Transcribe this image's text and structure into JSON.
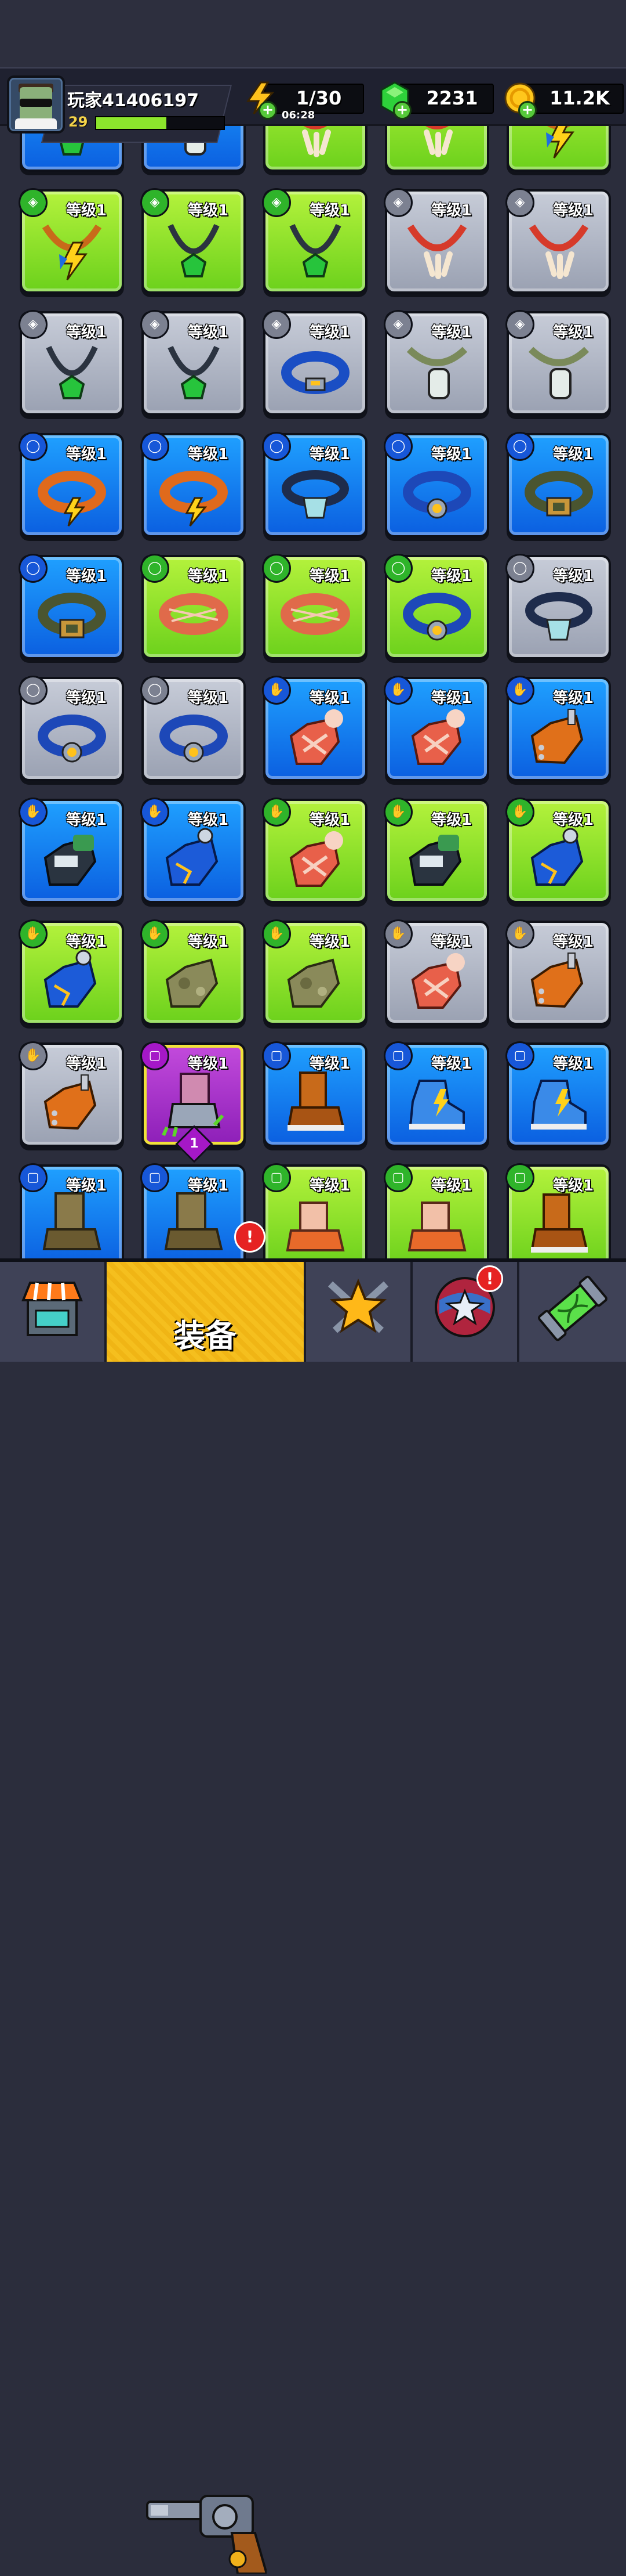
{
  "header": {
    "player_name": "玩家41406197",
    "player_level": "29",
    "xp_progress": 0.55,
    "energy": "1/30",
    "energy_timer": "06:28",
    "gems": "2231",
    "coins": "11.2K",
    "plus_symbol": "+"
  },
  "grid": {
    "level_label": "等级1",
    "rows": [
      [
        {
          "color": "blue",
          "item": "emerald-necklace"
        },
        {
          "color": "blue",
          "item": "dog-tag"
        },
        {
          "color": "green",
          "item": "bone-necklace"
        },
        {
          "color": "green",
          "item": "bone-necklace"
        },
        {
          "color": "green",
          "item": "lightning-necklace"
        }
      ],
      [
        {
          "color": "green",
          "item": "lightning-necklace",
          "slot": "necklace"
        },
        {
          "color": "green",
          "item": "emerald-necklace",
          "slot": "necklace"
        },
        {
          "color": "green",
          "item": "emerald-necklace",
          "slot": "necklace"
        },
        {
          "color": "gray",
          "item": "bone-necklace",
          "slot": "necklace"
        },
        {
          "color": "gray",
          "item": "bone-necklace",
          "slot": "necklace"
        }
      ],
      [
        {
          "color": "gray",
          "item": "emerald-necklace",
          "slot": "necklace"
        },
        {
          "color": "gray",
          "item": "emerald-necklace",
          "slot": "necklace"
        },
        {
          "color": "gray",
          "item": "blue-belt",
          "slot": "necklace"
        },
        {
          "color": "gray",
          "item": "dog-tag",
          "slot": "necklace"
        },
        {
          "color": "gray",
          "item": "dog-tag",
          "slot": "necklace"
        }
      ],
      [
        {
          "color": "blue",
          "item": "lightning-belt",
          "slot": "belt"
        },
        {
          "color": "blue",
          "item": "lightning-belt",
          "slot": "belt"
        },
        {
          "color": "blue",
          "item": "pouch-belt",
          "slot": "belt"
        },
        {
          "color": "blue",
          "item": "gold-buckle-belt",
          "slot": "belt"
        },
        {
          "color": "blue",
          "item": "leather-belt",
          "slot": "belt"
        }
      ],
      [
        {
          "color": "blue",
          "item": "leather-belt",
          "slot": "belt"
        },
        {
          "color": "green",
          "item": "bandage-belt",
          "slot": "belt"
        },
        {
          "color": "green",
          "item": "bandage-belt",
          "slot": "belt"
        },
        {
          "color": "green",
          "item": "gold-buckle-belt",
          "slot": "belt"
        },
        {
          "color": "gray",
          "item": "pouch-belt",
          "slot": "belt"
        }
      ],
      [
        {
          "color": "gray",
          "item": "gold-buckle-belt",
          "slot": "belt"
        },
        {
          "color": "gray",
          "item": "gold-buckle-belt",
          "slot": "belt"
        },
        {
          "color": "blue",
          "item": "bandaged-glove",
          "slot": "glove"
        },
        {
          "color": "blue",
          "item": "bandaged-glove",
          "slot": "glove"
        },
        {
          "color": "blue",
          "item": "spiked-glove",
          "slot": "glove"
        }
      ],
      [
        {
          "color": "blue",
          "item": "tech-glove",
          "slot": "glove"
        },
        {
          "color": "blue",
          "item": "blue-glove",
          "slot": "glove"
        },
        {
          "color": "green",
          "item": "bandaged-glove",
          "slot": "glove"
        },
        {
          "color": "green",
          "item": "tech-glove",
          "slot": "glove"
        },
        {
          "color": "green",
          "item": "blue-glove",
          "slot": "glove"
        }
      ],
      [
        {
          "color": "green",
          "item": "blue-glove",
          "slot": "glove"
        },
        {
          "color": "green",
          "item": "camo-glove",
          "slot": "glove"
        },
        {
          "color": "green",
          "item": "camo-glove",
          "slot": "glove"
        },
        {
          "color": "gray",
          "item": "bandaged-glove",
          "slot": "glove"
        },
        {
          "color": "gray",
          "item": "spiked-glove",
          "slot": "glove"
        }
      ],
      [
        {
          "color": "gray",
          "item": "spiked-glove",
          "slot": "glove"
        },
        {
          "color": "purple",
          "item": "claw-boot",
          "slot": "boot",
          "stars": "1"
        },
        {
          "color": "blue",
          "item": "leather-boot",
          "slot": "boot"
        },
        {
          "color": "blue",
          "item": "lightning-sneaker",
          "slot": "boot"
        },
        {
          "color": "blue",
          "item": "lightning-sneaker",
          "slot": "boot"
        }
      ],
      [
        {
          "color": "blue",
          "item": "camo-boot",
          "slot": "boot"
        },
        {
          "color": "blue",
          "item": "camo-boot",
          "slot": "boot"
        },
        {
          "color": "green",
          "item": "fur-boot",
          "slot": "boot"
        },
        {
          "color": "green",
          "item": "fur-boot",
          "slot": "boot"
        },
        {
          "color": "green",
          "item": "leather-boot",
          "slot": "boot"
        }
      ]
    ]
  },
  "nav": {
    "shop_icon": "shop-icon",
    "equipment_label": "装备",
    "equipment_icon": "revolver-icon",
    "talent_icon": "star-swords-icon",
    "events_icon": "globe-stars-icon",
    "lab_icon": "dna-capsule-icon",
    "alert_mark": "!"
  },
  "colors": {
    "green": "#7ed321",
    "blue": "#0f6ff0",
    "gray": "#a8aebc",
    "purple": "#a518c7",
    "active_tab": "#f4bd1c"
  }
}
